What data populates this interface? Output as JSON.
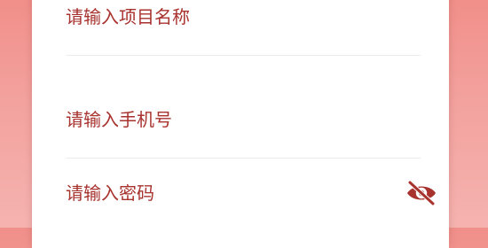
{
  "form": {
    "project_name": {
      "placeholder": "请输入项目名称"
    },
    "phone": {
      "placeholder": "请输入手机号"
    },
    "password": {
      "placeholder": "请输入密码",
      "toggle_icon": "eye-slash-icon"
    }
  },
  "colors": {
    "accent": "#a8322e",
    "background_top": "#f18f8a",
    "background_bottom": "#f5b3b0",
    "card": "#ffffff",
    "divider": "#ececec"
  }
}
